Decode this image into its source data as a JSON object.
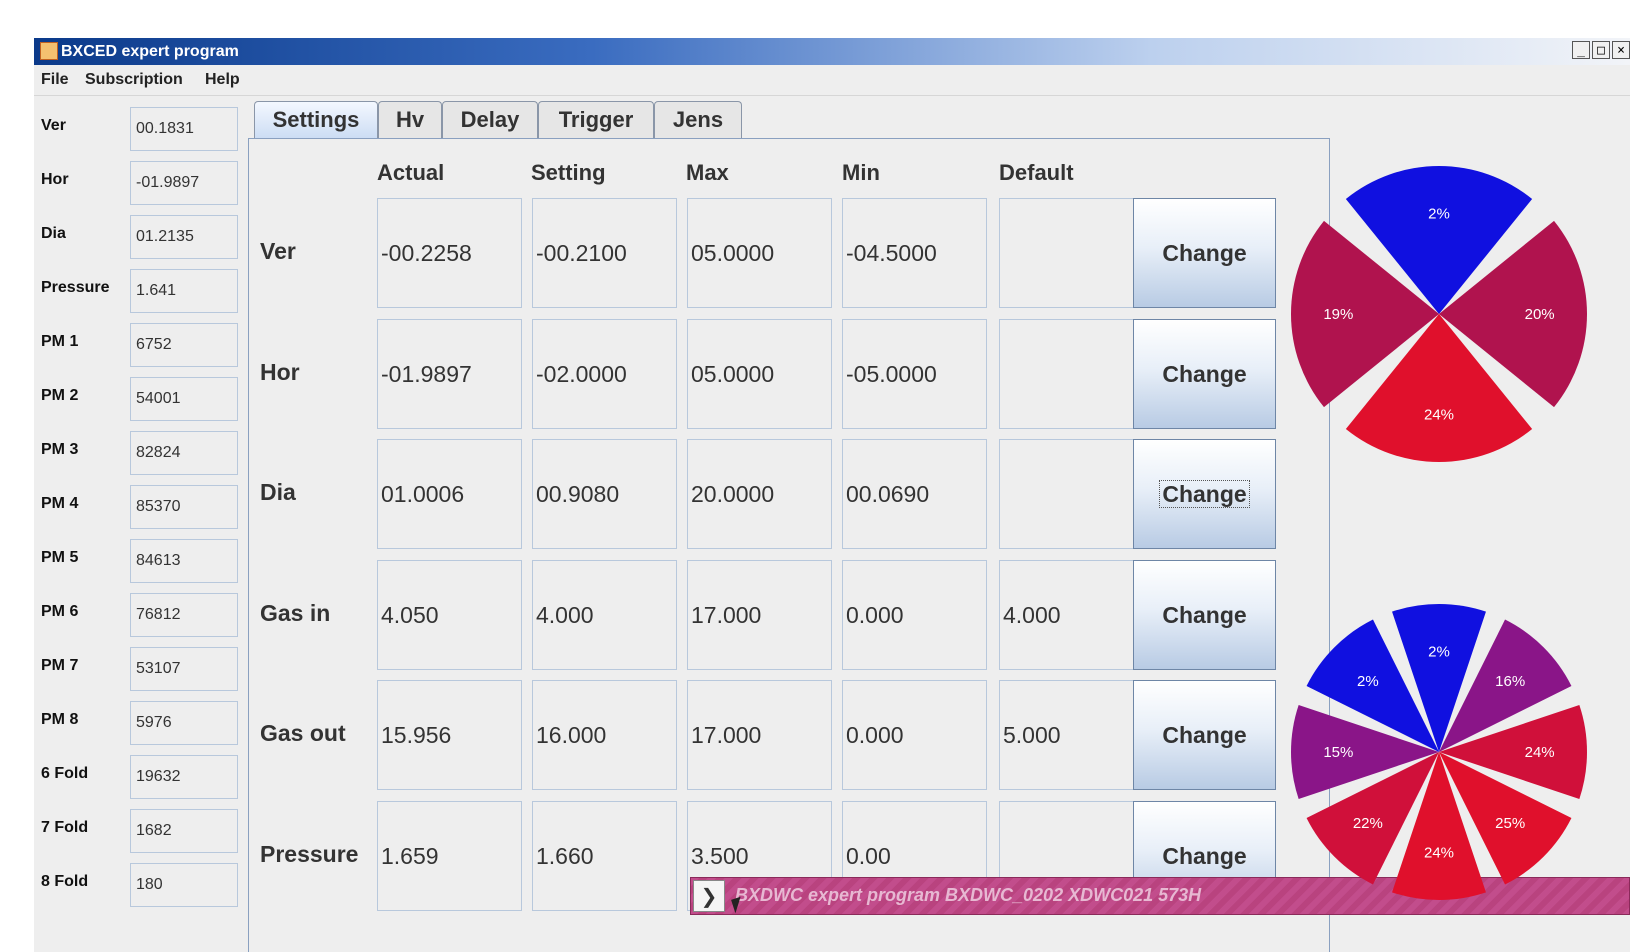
{
  "window": {
    "title": "BXCED expert program",
    "controls": [
      "_",
      "□",
      "×"
    ]
  },
  "menu": [
    "File",
    "Subscription",
    "Help"
  ],
  "side_fields": [
    {
      "label": "Ver",
      "value": "00.1831"
    },
    {
      "label": "Hor",
      "value": "-01.9897"
    },
    {
      "label": "Dia",
      "value": "01.2135"
    },
    {
      "label": "Pressure",
      "value": "1.641"
    },
    {
      "label": "PM 1",
      "value": "6752"
    },
    {
      "label": "PM 2",
      "value": "54001"
    },
    {
      "label": "PM 3",
      "value": "82824"
    },
    {
      "label": "PM 4",
      "value": "85370"
    },
    {
      "label": "PM 5",
      "value": "84613"
    },
    {
      "label": "PM 6",
      "value": "76812"
    },
    {
      "label": "PM 7",
      "value": "53107"
    },
    {
      "label": "PM 8",
      "value": "5976"
    },
    {
      "label": "6 Fold",
      "value": "19632"
    },
    {
      "label": "7 Fold",
      "value": "1682"
    },
    {
      "label": "8 Fold",
      "value": "180"
    }
  ],
  "tabs": [
    "Settings",
    "Hv",
    "Delay",
    "Trigger",
    "Jens"
  ],
  "active_tab": "Settings",
  "columns": [
    "Actual",
    "Setting",
    "Max",
    "Min",
    "Default"
  ],
  "rows": [
    {
      "label": "Ver",
      "cells": [
        "-00.2258",
        "-00.2100",
        "05.0000",
        "-04.5000",
        ""
      ],
      "button": "Change"
    },
    {
      "label": "Hor",
      "cells": [
        "-01.9897",
        "-02.0000",
        "05.0000",
        "-05.0000",
        ""
      ],
      "button": "Change"
    },
    {
      "label": "Dia",
      "cells": [
        "01.0006",
        "00.9080",
        "20.0000",
        "00.0690",
        ""
      ],
      "button": "Change"
    },
    {
      "label": "Gas in",
      "cells": [
        "4.050",
        "4.000",
        "17.000",
        "0.000",
        "4.000"
      ],
      "button": "Change"
    },
    {
      "label": "Gas out",
      "cells": [
        "15.956",
        "16.000",
        "17.000",
        "0.000",
        "5.000"
      ],
      "button": "Change"
    },
    {
      "label": "Pressure",
      "cells": [
        "1.659",
        "1.660",
        "3.500",
        "0.00",
        ""
      ],
      "button": "Change"
    }
  ],
  "pie_top": {
    "slices": [
      {
        "label": "2%",
        "color": "#1010e0"
      },
      {
        "label": "20%",
        "color": "#b0134e"
      },
      {
        "label": "24%",
        "color": "#e0102c"
      },
      {
        "label": "19%",
        "color": "#b0134e"
      }
    ]
  },
  "pie_bottom": {
    "slices": [
      {
        "label": "2%",
        "color": "#1010e0"
      },
      {
        "label": "16%",
        "color": "#8a1588"
      },
      {
        "label": "24%",
        "color": "#d0103a"
      },
      {
        "label": "25%",
        "color": "#e0102c"
      },
      {
        "label": "24%",
        "color": "#e0102c"
      },
      {
        "label": "22%",
        "color": "#d0103a"
      },
      {
        "label": "15%",
        "color": "#8a1588"
      },
      {
        "label": "2%",
        "color": "#1010e0"
      }
    ]
  },
  "taskbar": {
    "title": "BXDWC expert program BXDWC_0202 XDWC021 573H"
  }
}
